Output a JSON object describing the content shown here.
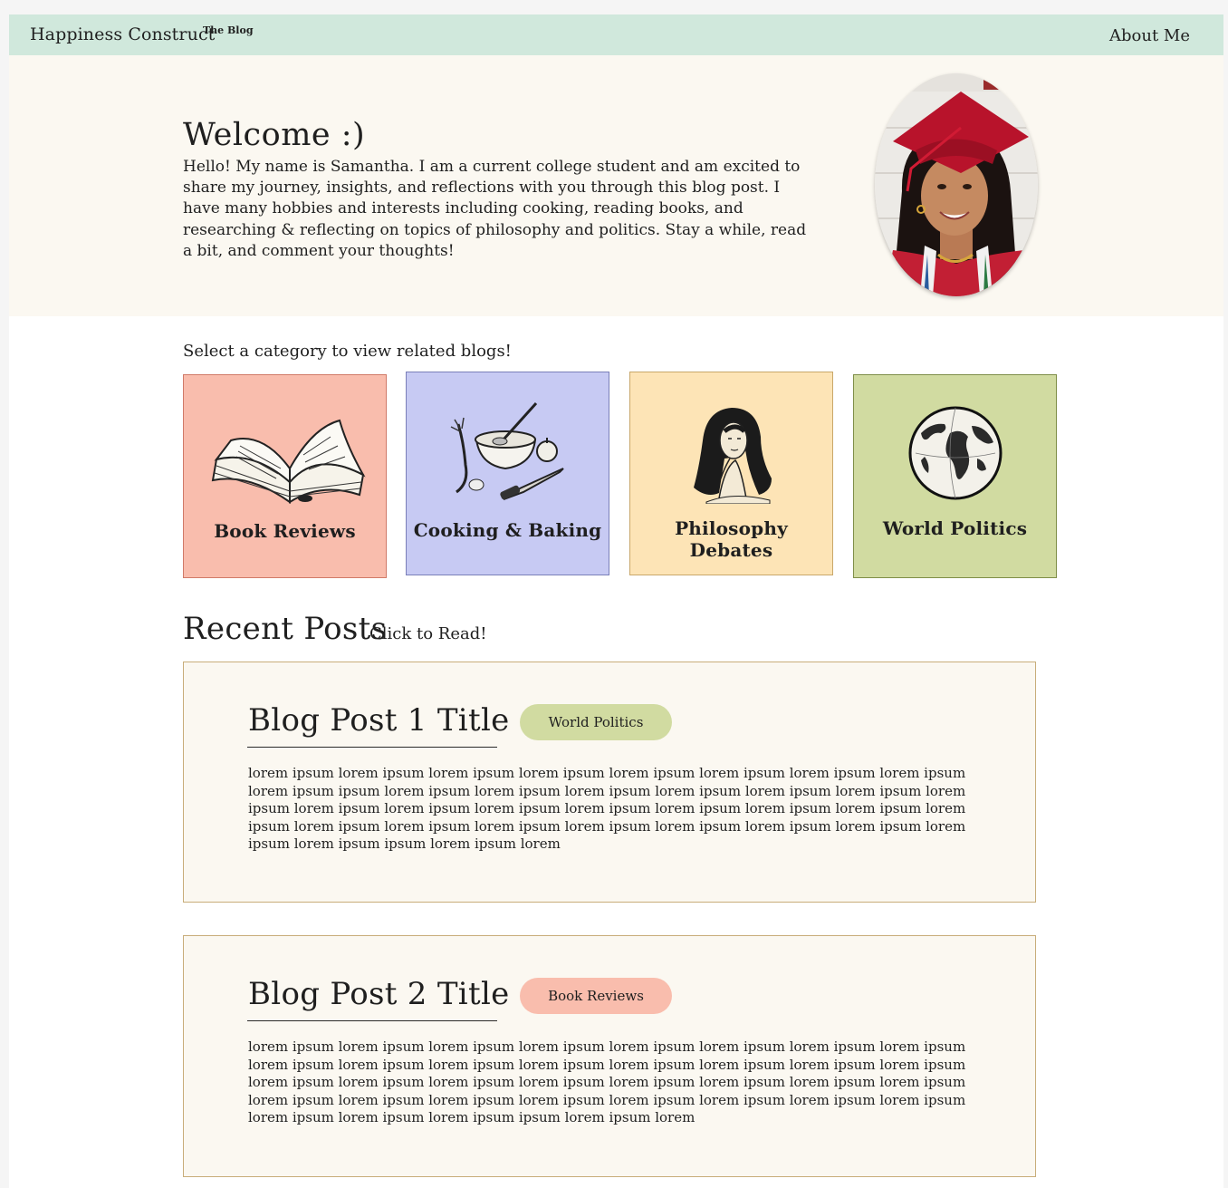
{
  "header": {
    "brand": "Happiness Construct",
    "brand_sub": "The Blog",
    "nav_about": "About Me"
  },
  "hero": {
    "title": "Welcome :)",
    "intro": "Hello! My name is Samantha. I am a current college student and am excited to share my journey, insights, and reflections with you through this blog post. I have many hobbies and interests including cooking, reading books, and  researching & reflecting on topics of philosophy and politics. Stay a while, read a bit, and comment your thoughts!",
    "portrait_icon": "graduate-portrait-photo"
  },
  "categories": {
    "prompt": "Select a category to view related blogs!",
    "items": [
      {
        "label": "Book Reviews",
        "icon": "open-book-icon",
        "color": "#f9bdad"
      },
      {
        "label": "Cooking & Baking",
        "icon": "cooking-bowl-icon",
        "color": "#c7caf3"
      },
      {
        "label": "Philosophy Debates",
        "icon": "thinking-woman-icon",
        "color": "#fde4b6"
      },
      {
        "label": "World Politics",
        "icon": "globe-icon",
        "color": "#d1dba1"
      }
    ]
  },
  "recent": {
    "title": "Recent Posts",
    "subtitle": "Click to Read!",
    "posts": [
      {
        "title": "Blog Post 1 Title",
        "tag": "World Politics",
        "tag_color": "#d1dba1",
        "body": "lorem ipsum lorem ipsum lorem ipsum lorem ipsum lorem ipsum lorem ipsum lorem ipsum lorem ipsum lorem ipsum ipsum lorem ipsum lorem ipsum lorem ipsum lorem ipsum lorem ipsum lorem ipsum lorem ipsum lorem ipsum lorem ipsum lorem ipsum lorem ipsum lorem ipsum lorem ipsum lorem ipsum lorem ipsum lorem ipsum lorem ipsum lorem ipsum lorem ipsum lorem ipsum lorem ipsum lorem ipsum lorem ipsum lorem ipsum ipsum lorem ipsum lorem"
      },
      {
        "title": "Blog Post 2 Title",
        "tag": "Book Reviews",
        "tag_color": "#f9bdad",
        "body": "lorem ipsum lorem ipsum lorem ipsum lorem ipsum lorem ipsum lorem ipsum lorem ipsum lorem ipsum lorem ipsum lorem ipsum lorem ipsum lorem ipsum lorem ipsum lorem ipsum lorem ipsum lorem ipsum lorem ipsum lorem ipsum lorem ipsum lorem ipsum lorem ipsum lorem ipsum lorem ipsum lorem ipsum lorem ipsum lorem ipsum lorem ipsum lorem ipsum lorem ipsum lorem ipsum lorem ipsum lorem ipsum lorem ipsum lorem ipsum lorem ipsum ipsum lorem ipsum lorem"
      }
    ]
  },
  "colors": {
    "header_bg": "#d0e8dc",
    "hero_bg": "#fbf8f1",
    "post_border": "#c8ad7a"
  }
}
